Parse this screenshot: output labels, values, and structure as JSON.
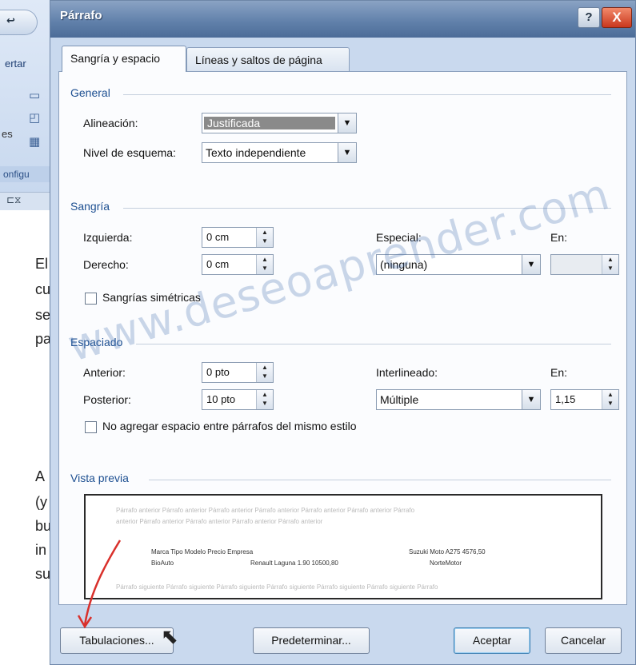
{
  "background": {
    "qat_text": "↩",
    "tab_label": "ertar",
    "side_text": "es",
    "config_label": "onfigu",
    "doc_letters": [
      "El",
      "cu",
      "se",
      "pa",
      "A",
      "(y",
      "bu",
      "in",
      "su"
    ]
  },
  "dialog": {
    "title": "Párrafo",
    "help_label": "?",
    "close_label": "X",
    "tabs": [
      {
        "label": "Sangría y espacio",
        "active": true
      },
      {
        "label": "Líneas y saltos de página",
        "active": false
      }
    ],
    "general": {
      "header": "General",
      "alineacion_label": "Alineación:",
      "alineacion_value": "Justificada",
      "nivel_label": "Nivel de esquema:",
      "nivel_value": "Texto independiente"
    },
    "sangria": {
      "header": "Sangría",
      "izquierda_label": "Izquierda:",
      "izquierda_value": "0 cm",
      "derecho_label": "Derecho:",
      "derecho_value": "0 cm",
      "especial_label": "Especial:",
      "especial_value": "(ninguna)",
      "en_label": "En:",
      "en_value": "",
      "simetricas_label": "Sangrías simétricas",
      "simetricas_checked": false
    },
    "espaciado": {
      "header": "Espaciado",
      "anterior_label": "Anterior:",
      "anterior_value": "0 pto",
      "posterior_label": "Posterior:",
      "posterior_value": "10 pto",
      "interlineado_label": "Interlineado:",
      "interlineado_value": "Múltiple",
      "en_label": "En:",
      "en_value": "1,15",
      "no_agregar_label": "No agregar espacio entre párrafos del mismo estilo",
      "no_agregar_checked": false
    },
    "vista_previa": {
      "header": "Vista previa",
      "gray_line_1": "Párrafo anterior Párrafo anterior Párrafo anterior Párrafo anterior Párrafo anterior Párrafo anterior Párrafo",
      "gray_line_2": "anterior Párrafo anterior Párrafo anterior Párrafo anterior Párrafo anterior",
      "row1_left": "Marca   Tipo    Modelo  Precio   Empresa",
      "row1_right": "Suzuki    Moto    A275    4576,50",
      "row2_left": "BioAuto",
      "row2_mid": "Renault  Laguna   1.90     10500,80",
      "row2_right": "NorteMotor",
      "gray_line_3": "Párrafo siguiente Párrafo siguiente Párrafo siguiente Párrafo siguiente Párrafo siguiente Párrafo siguiente Párrafo"
    },
    "buttons": {
      "tabulaciones": "Tabulaciones...",
      "predeterminar": "Predeterminar...",
      "aceptar": "Aceptar",
      "cancelar": "Cancelar"
    },
    "watermark": "www.deseoaprender.com"
  },
  "colors": {
    "section_header": "#1d4f91",
    "annotation_arrow": "#d9302b"
  }
}
